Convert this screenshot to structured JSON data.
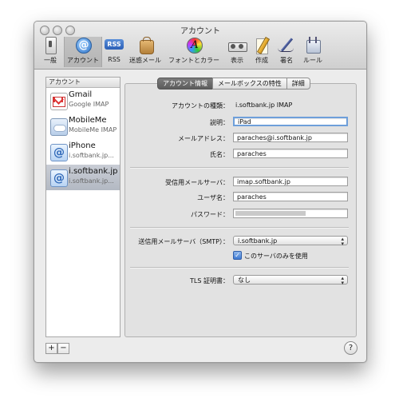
{
  "window": {
    "title": "アカウント"
  },
  "toolbar": {
    "items": [
      {
        "label": "一般"
      },
      {
        "label": "アカウント"
      },
      {
        "label": "RSS",
        "badge": "RSS"
      },
      {
        "label": "迷惑メール"
      },
      {
        "label": "フォントとカラー",
        "glyph": "A"
      },
      {
        "label": "表示"
      },
      {
        "label": "作成"
      },
      {
        "label": "署名"
      },
      {
        "label": "ルール"
      }
    ]
  },
  "sidebar": {
    "header": "アカウント",
    "accounts": [
      {
        "name": "Gmail",
        "sub": "Google IMAP",
        "icon": "gmail-icon"
      },
      {
        "name": "MobileMe",
        "sub": "MobileMe IMAP",
        "icon": "mobileme-icon"
      },
      {
        "name": "iPhone",
        "sub": "i.softbank.jp...",
        "icon": "at-sign-icon"
      },
      {
        "name": "i.softbank.jp",
        "sub": "i.softbank.jp...",
        "icon": "at-sign-icon"
      }
    ],
    "add_label": "+",
    "remove_label": "−"
  },
  "tabs": [
    {
      "label": "アカウント情報"
    },
    {
      "label": "メールボックスの特性"
    },
    {
      "label": "詳細"
    }
  ],
  "form": {
    "account_type_label": "アカウントの種類：",
    "account_type_value": "i.softbank.jp IMAP",
    "description_label": "説明：",
    "description_value": "iPad",
    "email_label": "メールアドレス：",
    "email_value": "paraches@i.softbank.jp",
    "name_label": "氏名：",
    "name_value": "paraches",
    "incoming_label": "受信用メールサーバ：",
    "incoming_value": "imap.softbank.jp",
    "username_label": "ユーザ名：",
    "username_value": "paraches",
    "password_label": "パスワード：",
    "smtp_label": "送信用メールサーバ（SMTP）：",
    "smtp_value": "i.softbank.jp",
    "only_this_server_label": "このサーバのみを使用",
    "only_this_server_checked": true,
    "tls_label": "TLS 証明書：",
    "tls_value": "なし"
  },
  "help_label": "?",
  "colors": {
    "focus_ring": "#6e9fda",
    "selection": "#b3b9c3",
    "checkbox": "#3f7bd3"
  }
}
